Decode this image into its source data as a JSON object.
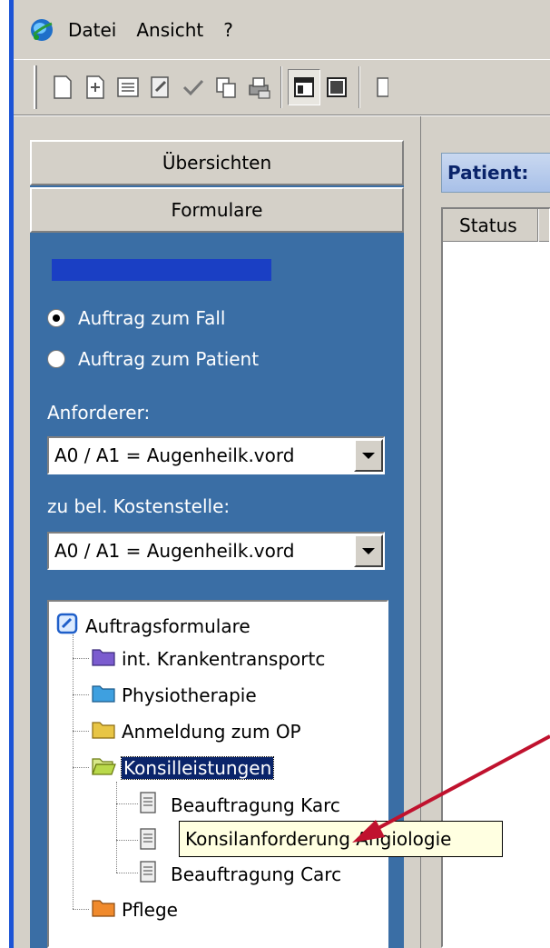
{
  "menubar": {
    "app_icon": "globe-icon",
    "items": [
      "Datei",
      "Ansicht",
      "?"
    ]
  },
  "toolbar": {
    "buttons": [
      "new-document-icon",
      "add-document-icon",
      "list-form-icon",
      "edit-form-icon",
      "check-icon",
      "copy-icon",
      "print-icon",
      "split-view-icon",
      "single-view-icon"
    ]
  },
  "sidebar": {
    "sections": [
      "Übersichten",
      "Formulare"
    ],
    "radios": [
      {
        "label": "Auftrag zum Fall",
        "checked": true
      },
      {
        "label": "Auftrag zum Patient",
        "checked": false
      }
    ],
    "requester_label": "Anforderer:",
    "requester_value": "A0 / A1 = Augenheilk.vord",
    "costcenter_label": "zu bel. Kostenstelle:",
    "costcenter_value": "A0 / A1 = Augenheilk.vord"
  },
  "tree": {
    "root": "Auftragsformulare",
    "folders": [
      {
        "label": "int. Krankentransportc",
        "color": "#7b5ccf"
      },
      {
        "label": "Physiotherapie",
        "color": "#3ea0e0"
      },
      {
        "label": "Anmeldung zum OP",
        "color": "#e8c545"
      },
      {
        "label": "Konsilleistungen",
        "color": "#b9d94a",
        "selected": true
      },
      {
        "label": "Pflege",
        "color": "#f08a2c"
      }
    ],
    "documents": [
      "Beauftragung Karc",
      "Konsilanforderung Angiologie",
      "Beauftragung Carc"
    ]
  },
  "tooltip": "Konsilanforderung Angiologie",
  "main": {
    "patient_label": "Patient:",
    "grid_header": "Status"
  },
  "colors": {
    "panel_blue": "#3a6ea5",
    "window_gray": "#d4d0c8",
    "arrow_red": "#c0122e"
  }
}
